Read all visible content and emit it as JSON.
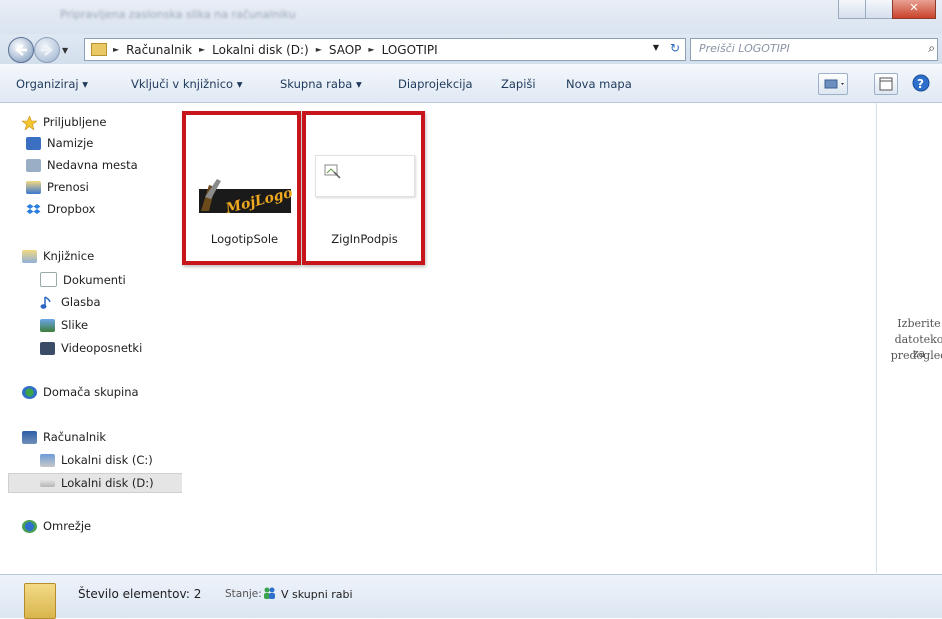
{
  "window": {
    "title": "Pripravljena zaslonska slika na računalniku"
  },
  "address": {
    "crumbs": [
      "Računalnik",
      "Lokalni disk (D:)",
      "SAOP",
      "LOGOTIPI"
    ],
    "search_placeholder": "Preišči LOGOTIPI"
  },
  "toolbar": {
    "organize": "Organiziraj ▾",
    "include": "Vključi v knjižnico ▾",
    "share": "Skupna raba ▾",
    "slideshow": "Diaprojekcija",
    "burn": "Zapiši",
    "new_folder": "Nova mapa"
  },
  "nav": {
    "favorites": "Priljubljene",
    "desktop": "Namizje",
    "recent": "Nedavna mesta",
    "downloads": "Prenosi",
    "dropbox": "Dropbox",
    "libraries": "Knjižnice",
    "documents": "Dokumenti",
    "music": "Glasba",
    "pictures": "Slike",
    "videos": "Videoposnetki",
    "homegroup": "Domača skupina",
    "computer": "Računalnik",
    "disk_c": "Lokalni disk (C:)",
    "disk_d": "Lokalni disk (D:)",
    "network": "Omrežje"
  },
  "files": [
    {
      "name": "LogotipSole",
      "logo_text": "MojLogo"
    },
    {
      "name": "ZigInPodpis"
    }
  ],
  "preview": {
    "line1": "Izberite",
    "line2": "datoteko za",
    "line3": "predogled"
  },
  "status": {
    "count": "Število elementov: 2",
    "state_label": "Stanje:",
    "state_value": "V skupni rabi"
  },
  "colors": {
    "highlight_border": "#c8141b",
    "toolbar_bg": "#dfe8f3"
  }
}
